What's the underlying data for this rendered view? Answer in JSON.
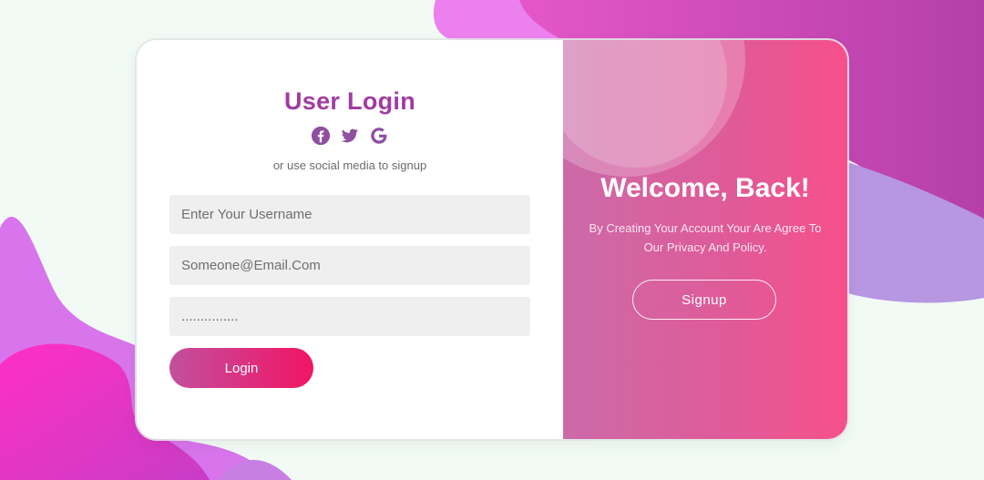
{
  "login": {
    "title": "User Login",
    "social_hint": "or use social media to signup",
    "social_icons": [
      "facebook-icon",
      "twitter-icon",
      "google-icon"
    ],
    "username": {
      "placeholder": "Enter Your Username",
      "value": ""
    },
    "email": {
      "placeholder": "Someone@Email.Com",
      "value": ""
    },
    "password": {
      "placeholder": "",
      "value": "..............."
    },
    "button_label": "Login"
  },
  "welcome_panel": {
    "heading": "Welcome, Back!",
    "description": "By Creating Your Account Your Are Agree To Our Privacy And Policy.",
    "button_label": "Signup"
  },
  "colors": {
    "title": "#a13ba0",
    "icon": "#8e4fa0",
    "login_gradient_start": "#c2509d",
    "login_gradient_end": "#f21466",
    "panel_gradient_start": "#cc6aa8",
    "panel_gradient_end": "#f7508a",
    "background": "#f1faf5"
  }
}
